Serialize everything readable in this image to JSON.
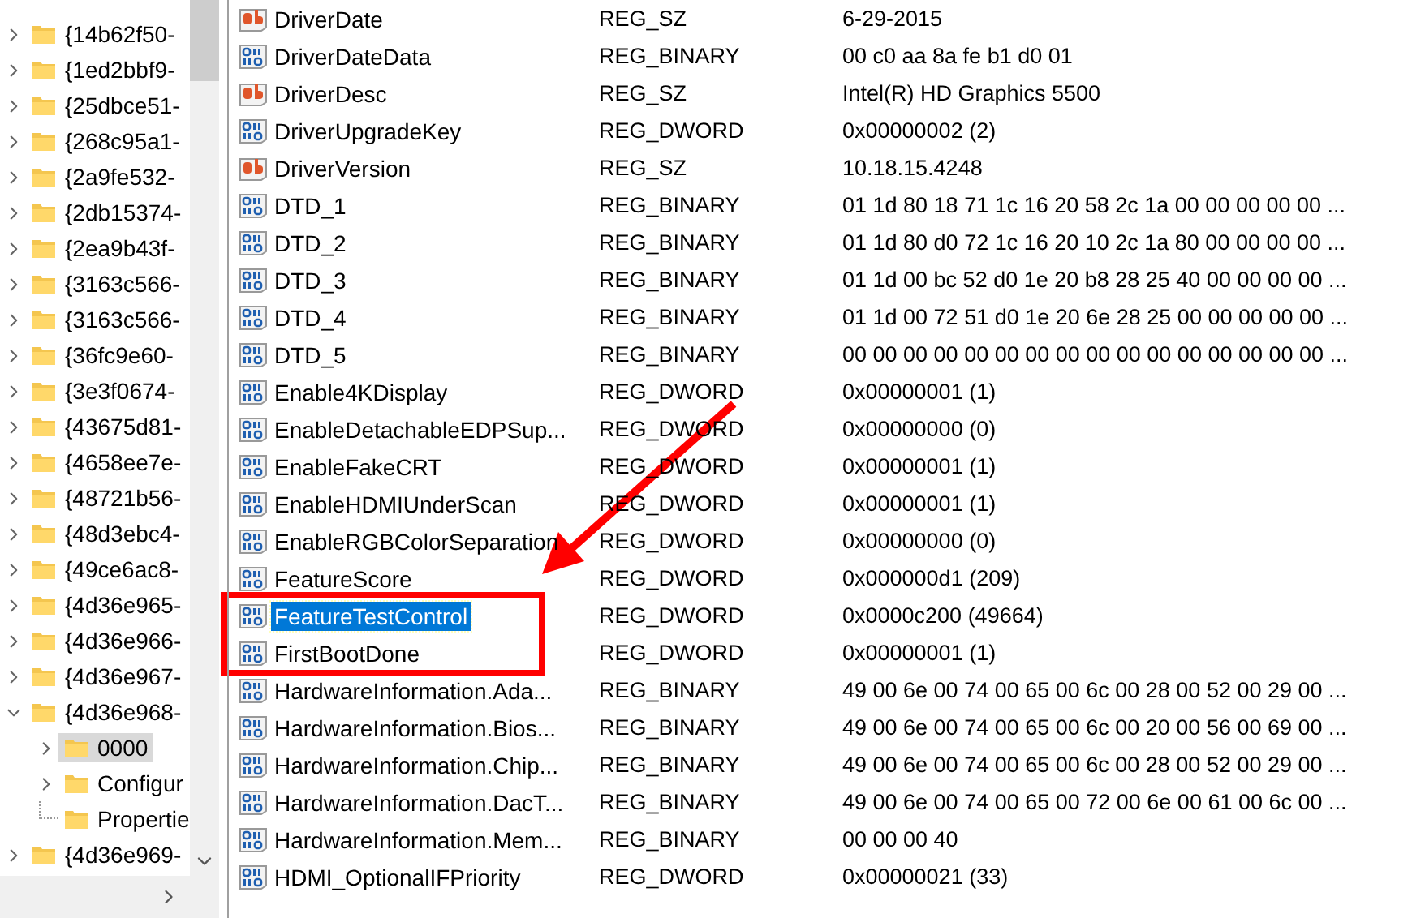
{
  "tree": {
    "items": [
      {
        "label": "{14b62f50-",
        "expandable": true,
        "expanded": false,
        "selected": false
      },
      {
        "label": "{1ed2bbf9-",
        "expandable": true,
        "expanded": false,
        "selected": false
      },
      {
        "label": "{25dbce51-",
        "expandable": true,
        "expanded": false,
        "selected": false
      },
      {
        "label": "{268c95a1-",
        "expandable": true,
        "expanded": false,
        "selected": false
      },
      {
        "label": "{2a9fe532-",
        "expandable": true,
        "expanded": false,
        "selected": false
      },
      {
        "label": "{2db15374-",
        "expandable": true,
        "expanded": false,
        "selected": false
      },
      {
        "label": "{2ea9b43f-",
        "expandable": true,
        "expanded": false,
        "selected": false
      },
      {
        "label": "{3163c566-",
        "expandable": true,
        "expanded": false,
        "selected": false
      },
      {
        "label": "{3163c566-",
        "expandable": true,
        "expanded": false,
        "selected": false
      },
      {
        "label": "{36fc9e60-",
        "expandable": true,
        "expanded": false,
        "selected": false
      },
      {
        "label": "{3e3f0674-",
        "expandable": true,
        "expanded": false,
        "selected": false
      },
      {
        "label": "{43675d81-",
        "expandable": true,
        "expanded": false,
        "selected": false
      },
      {
        "label": "{4658ee7e-",
        "expandable": true,
        "expanded": false,
        "selected": false
      },
      {
        "label": "{48721b56-",
        "expandable": true,
        "expanded": false,
        "selected": false
      },
      {
        "label": "{48d3ebc4-",
        "expandable": true,
        "expanded": false,
        "selected": false
      },
      {
        "label": "{49ce6ac8-",
        "expandable": true,
        "expanded": false,
        "selected": false
      },
      {
        "label": "{4d36e965-",
        "expandable": true,
        "expanded": false,
        "selected": false
      },
      {
        "label": "{4d36e966-",
        "expandable": true,
        "expanded": false,
        "selected": false
      },
      {
        "label": "{4d36e967-",
        "expandable": true,
        "expanded": false,
        "selected": false
      },
      {
        "label": "{4d36e968-",
        "expandable": true,
        "expanded": true,
        "selected": false,
        "children": [
          {
            "label": "0000",
            "expandable": true,
            "expanded": false,
            "selected": true
          },
          {
            "label": "Configur",
            "expandable": true,
            "expanded": false,
            "selected": false
          },
          {
            "label": "Propertie",
            "expandable": false,
            "selected": false
          }
        ]
      },
      {
        "label": "{4d36e969-",
        "expandable": true,
        "expanded": false,
        "selected": false
      }
    ]
  },
  "values": {
    "rows": [
      {
        "name": "DriverDate",
        "kind": "string",
        "type": "REG_SZ",
        "data": "6-29-2015",
        "selected": false
      },
      {
        "name": "DriverDateData",
        "kind": "binary",
        "type": "REG_BINARY",
        "data": "00 c0 aa 8a fe b1 d0 01",
        "selected": false
      },
      {
        "name": "DriverDesc",
        "kind": "string",
        "type": "REG_SZ",
        "data": "Intel(R) HD Graphics 5500",
        "selected": false
      },
      {
        "name": "DriverUpgradeKey",
        "kind": "binary",
        "type": "REG_DWORD",
        "data": "0x00000002 (2)",
        "selected": false
      },
      {
        "name": "DriverVersion",
        "kind": "string",
        "type": "REG_SZ",
        "data": "10.18.15.4248",
        "selected": false
      },
      {
        "name": "DTD_1",
        "kind": "binary",
        "type": "REG_BINARY",
        "data": "01 1d 80 18 71 1c 16 20 58 2c 1a 00 00 00 00 00 ...",
        "selected": false
      },
      {
        "name": "DTD_2",
        "kind": "binary",
        "type": "REG_BINARY",
        "data": "01 1d 80 d0 72 1c 16 20 10 2c 1a 80 00 00 00 00 ...",
        "selected": false
      },
      {
        "name": "DTD_3",
        "kind": "binary",
        "type": "REG_BINARY",
        "data": "01 1d 00 bc 52 d0 1e 20 b8 28 25 40 00 00 00 00 ...",
        "selected": false
      },
      {
        "name": "DTD_4",
        "kind": "binary",
        "type": "REG_BINARY",
        "data": "01 1d 00 72 51 d0 1e 20 6e 28 25 00 00 00 00 00 ...",
        "selected": false
      },
      {
        "name": "DTD_5",
        "kind": "binary",
        "type": "REG_BINARY",
        "data": "00 00 00 00 00 00 00 00 00 00 00 00 00 00 00 00 ...",
        "selected": false
      },
      {
        "name": "Enable4KDisplay",
        "kind": "binary",
        "type": "REG_DWORD",
        "data": "0x00000001 (1)",
        "selected": false
      },
      {
        "name": "EnableDetachableEDPSup...",
        "kind": "binary",
        "type": "REG_DWORD",
        "data": "0x00000000 (0)",
        "selected": false
      },
      {
        "name": "EnableFakeCRT",
        "kind": "binary",
        "type": "REG_DWORD",
        "data": "0x00000001 (1)",
        "selected": false
      },
      {
        "name": "EnableHDMIUnderScan",
        "kind": "binary",
        "type": "REG_DWORD",
        "data": "0x00000001 (1)",
        "selected": false
      },
      {
        "name": "EnableRGBColorSeparation",
        "kind": "binary",
        "type": "REG_DWORD",
        "data": "0x00000000 (0)",
        "selected": false
      },
      {
        "name": "FeatureScore",
        "kind": "binary",
        "type": "REG_DWORD",
        "data": "0x000000d1 (209)",
        "selected": false
      },
      {
        "name": "FeatureTestControl",
        "kind": "binary",
        "type": "REG_DWORD",
        "data": "0x0000c200 (49664)",
        "selected": true
      },
      {
        "name": "FirstBootDone",
        "kind": "binary",
        "type": "REG_DWORD",
        "data": "0x00000001 (1)",
        "selected": false
      },
      {
        "name": "HardwareInformation.Ada...",
        "kind": "binary",
        "type": "REG_BINARY",
        "data": "49 00 6e 00 74 00 65 00 6c 00 28 00 52 00 29 00 ...",
        "selected": false
      },
      {
        "name": "HardwareInformation.Bios...",
        "kind": "binary",
        "type": "REG_BINARY",
        "data": "49 00 6e 00 74 00 65 00 6c 00 20 00 56 00 69 00 ...",
        "selected": false
      },
      {
        "name": "HardwareInformation.Chip...",
        "kind": "binary",
        "type": "REG_BINARY",
        "data": "49 00 6e 00 74 00 65 00 6c 00 28 00 52 00 29 00 ...",
        "selected": false
      },
      {
        "name": "HardwareInformation.DacT...",
        "kind": "binary",
        "type": "REG_BINARY",
        "data": "49 00 6e 00 74 00 65 00 72 00 6e 00 61 00 6c 00 ...",
        "selected": false
      },
      {
        "name": "HardwareInformation.Mem...",
        "kind": "binary",
        "type": "REG_BINARY",
        "data": "00 00 00 40",
        "selected": false
      },
      {
        "name": "HDMI_OptionalIFPriority",
        "kind": "binary",
        "type": "REG_DWORD",
        "data": "0x00000021 (33)",
        "selected": false
      }
    ]
  },
  "annotations": {
    "arrow": true,
    "box": true
  }
}
